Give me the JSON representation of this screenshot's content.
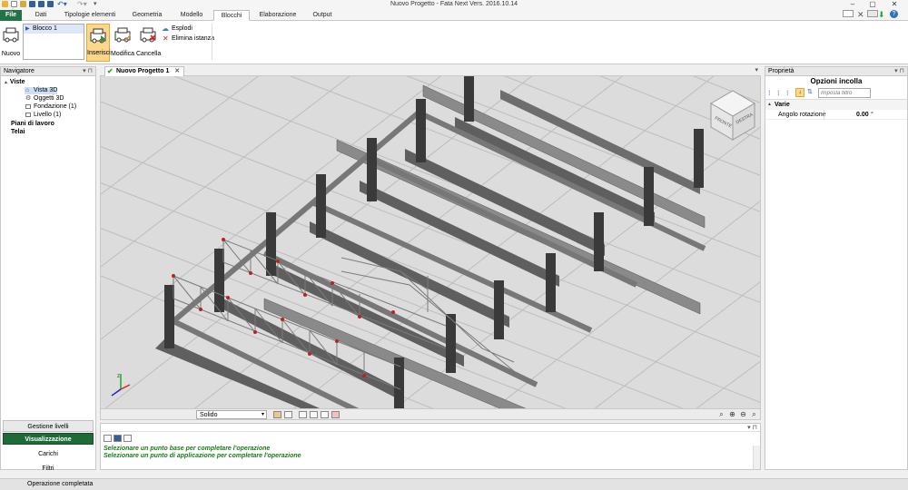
{
  "window": {
    "title": "Nuovo Progetto - Fata Next Vers. 2016.10.14",
    "buttons": [
      "–",
      "▢",
      "✕"
    ]
  },
  "menu_tabs": [
    "File",
    "Dati",
    "Tipologie elementi",
    "Geometria",
    "Modello",
    "Blocchi",
    "Elaborazione",
    "Output"
  ],
  "active_tab": "Blocchi",
  "ribbon": {
    "new_label": "Nuovo",
    "block_list_item": "Blocco 1",
    "insert_label": "Inserisci",
    "modify_label": "Modifica",
    "delete_label": "Cancella",
    "explode_label": "Esplodi",
    "delete_instance_label": "Elimina istanza"
  },
  "navigator": {
    "title": "Navigatore",
    "tree": [
      {
        "label": "Viste",
        "bold": true,
        "level": 0,
        "expander": "▲"
      },
      {
        "label": "Vista 3D",
        "level": 2,
        "selected": true
      },
      {
        "label": "Oggetti 3D",
        "level": 2
      },
      {
        "label": "Fondazione (1)",
        "level": 2
      },
      {
        "label": "Livello (1)",
        "level": 2
      },
      {
        "label": "Piani di lavoro",
        "bold": true,
        "level": 0
      },
      {
        "label": "Telai",
        "bold": true,
        "level": 0
      }
    ],
    "buttons": [
      "Gestione livelli",
      "Visualizzazione",
      "Carichi",
      "Filtri"
    ],
    "active_button": "Visualizzazione"
  },
  "document_tab": {
    "label": "Nuovo Progetto 1",
    "close": "✕"
  },
  "viewcube": {
    "faces": [
      "FRONTE",
      "DESTRA"
    ]
  },
  "viewport_toolbar": {
    "mode": "Solido"
  },
  "command_messages": [
    "Selezionare un punto base per completare l'operazione",
    "Selezionare un punto di applicazione per completare l'operazione"
  ],
  "properties": {
    "title": "Proprietà",
    "header": "Opzioni incolla",
    "filter_placeholder": "Imposta filtro",
    "category": "Varie",
    "rows": [
      {
        "name": "Angolo rotazione",
        "value": "0.00",
        "unit": "°"
      }
    ]
  },
  "status": "Operazione completata",
  "colors": {
    "file_tab": "#217346",
    "active_nav": "#1e6b38",
    "selected_button": "#fbd78c",
    "message_text": "#1b7a1b"
  }
}
